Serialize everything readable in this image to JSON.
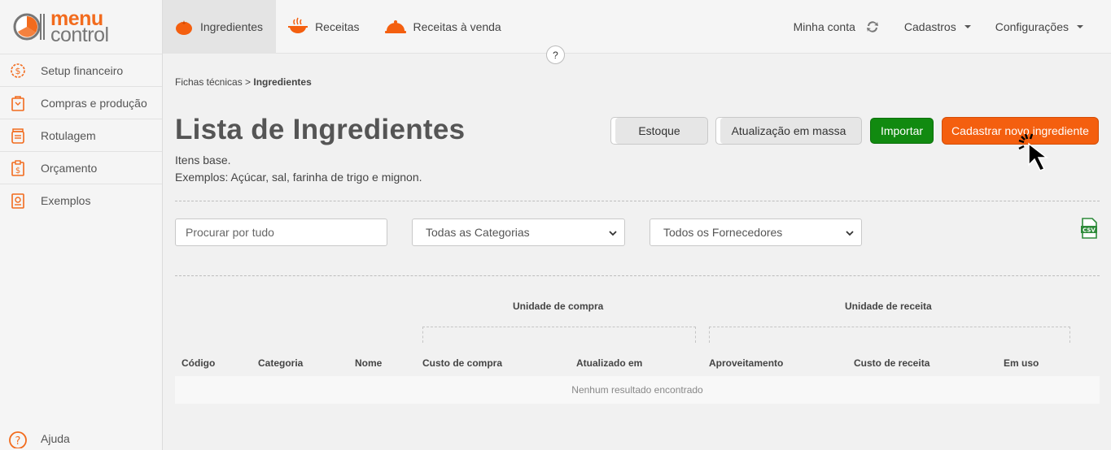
{
  "brand": {
    "line1": "menu",
    "line2": "control"
  },
  "sidebar": {
    "items": [
      {
        "label": "Setup financeiro",
        "icon": "gear-dollar-icon"
      },
      {
        "label": "Compras e produção",
        "icon": "shopping-bag-icon"
      },
      {
        "label": "Rotulagem",
        "icon": "jar-label-icon"
      },
      {
        "label": "Orçamento",
        "icon": "clipboard-dollar-icon"
      },
      {
        "label": "Exemplos",
        "icon": "examples-book-icon"
      }
    ],
    "help_label": "Ajuda"
  },
  "topnav": {
    "tabs": [
      {
        "label": "Ingredientes",
        "icon": "tomato-icon",
        "active": true
      },
      {
        "label": "Receitas",
        "icon": "cooking-pot-icon",
        "active": false
      },
      {
        "label": "Receitas à venda",
        "icon": "cloche-icon",
        "active": false
      }
    ],
    "account_label": "Minha conta",
    "cadastros_label": "Cadastros",
    "config_label": "Configurações",
    "help_bubble": "?"
  },
  "breadcrumb": {
    "parent": "Fichas técnicas",
    "separator": " > ",
    "current": "Ingredientes"
  },
  "page": {
    "title": "Lista de Ingredientes",
    "desc_line1": "Itens base.",
    "desc_line2": "Exemplos: Açúcar, sal, farinha de trigo e mignon."
  },
  "actions": {
    "estoque": "Estoque",
    "massa": "Atualização em massa",
    "importar": "Importar",
    "novo": "Cadastrar novo ingrediente"
  },
  "filters": {
    "search_placeholder": "Procurar por tudo",
    "category_selected": "Todas as Categorias",
    "supplier_selected": "Todos os Fornecedores"
  },
  "table": {
    "group_compra": "Unidade de compra",
    "group_receita": "Unidade de receita",
    "columns": [
      "Código",
      "Categoria",
      "Nome",
      "Custo de compra",
      "Atualizado em",
      "Aproveitamento",
      "Custo de receita",
      "Em uso"
    ],
    "empty_message": "Nenhum resultado encontrado"
  },
  "colors": {
    "brand_orange": "#f26b1d",
    "primary_button": "#f45f0f",
    "import_button": "#118a10",
    "csv_green": "#2e8b3a"
  }
}
